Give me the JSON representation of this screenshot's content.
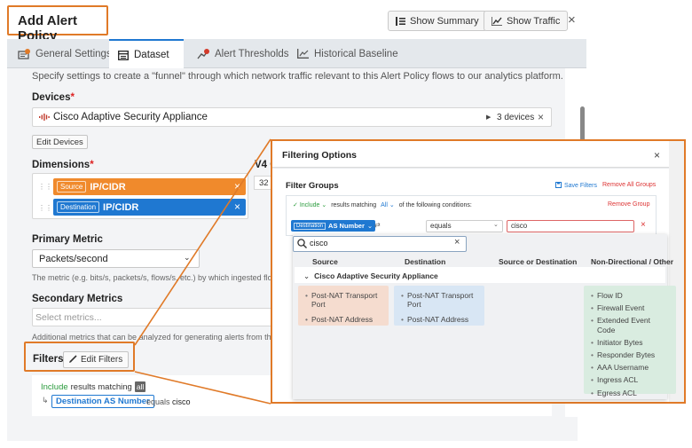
{
  "header": {
    "title": "Add Alert Policy",
    "show_summary": "Show Summary",
    "show_traffic": "Show Traffic",
    "close": "×"
  },
  "tabs": [
    {
      "label": "General Settings"
    },
    {
      "label": "Dataset"
    },
    {
      "label": "Alert Thresholds"
    },
    {
      "label": "Historical Baseline"
    }
  ],
  "dataset": {
    "intro": "Specify settings to create a \"funnel\" through which network traffic relevant to this Alert Policy flows to our analytics platform.",
    "devices_label": "Devices",
    "required_mark": "*",
    "device_name": "Cisco Adaptive Security Appliance",
    "device_count": "3 devices",
    "edit_devices": "Edit Devices",
    "dimensions_label": "Dimensions",
    "v4_label": "V4 C",
    "v4_value": "32",
    "dim_source_tag": "Source",
    "dim_source_value": "IP/CIDR",
    "dim_dest_tag": "Destination",
    "dim_dest_value": "IP/CIDR",
    "primary_metric_label": "Primary Metric",
    "primary_metric_value": "Packets/second",
    "primary_metric_help": "The metric (e.g. bits/s, packets/s, flows/s, etc.) by which ingested flow",
    "secondary_metrics_label": "Secondary Metrics",
    "secondary_placeholder": "Select metrics...",
    "secondary_help": "Additional metrics that can be analyzed for generating alerts from this",
    "filters_label": "Filters",
    "edit_filters": "Edit Filters",
    "include_word": "Include",
    "results_matching": "results matching",
    "all_badge": "all",
    "filter_dim": "Destination AS Number",
    "filter_op": "equals",
    "filter_val": "cisco"
  },
  "popup": {
    "title": "Filtering Options",
    "close": "×",
    "filter_groups": "Filter Groups",
    "save_filters": "Save Filters",
    "remove_all_groups": "Remove All Groups",
    "include": "Include",
    "results_matching": "results matching",
    "all": "All",
    "conditions": "of the following conditions:",
    "remove_group": "Remove Group",
    "row_dim_tag": "Destination",
    "row_dim_value": "AS Number",
    "row_operator": "equals",
    "row_value": "cisco",
    "search_value": "cisco",
    "columns": [
      "Source",
      "Destination",
      "Source or Destination",
      "Non-Directional / Other"
    ],
    "device_group": "Cisco Adaptive Security Appliance",
    "source_options": [
      "Post-NAT Transport Port",
      "Post-NAT Address"
    ],
    "destination_options": [
      "Post-NAT Transport Port",
      "Post-NAT Address"
    ],
    "other_options": [
      "Flow ID",
      "Firewall Event",
      "Extended Event Code",
      "Initiator Bytes",
      "Responder Bytes",
      "AAA Username",
      "Ingress ACL",
      "Egress ACL"
    ]
  },
  "colors": {
    "accent_orange": "#e07a28",
    "source_orange": "#f08a2c",
    "destination_blue": "#1f78d1",
    "link_green": "#2a9b3c"
  }
}
